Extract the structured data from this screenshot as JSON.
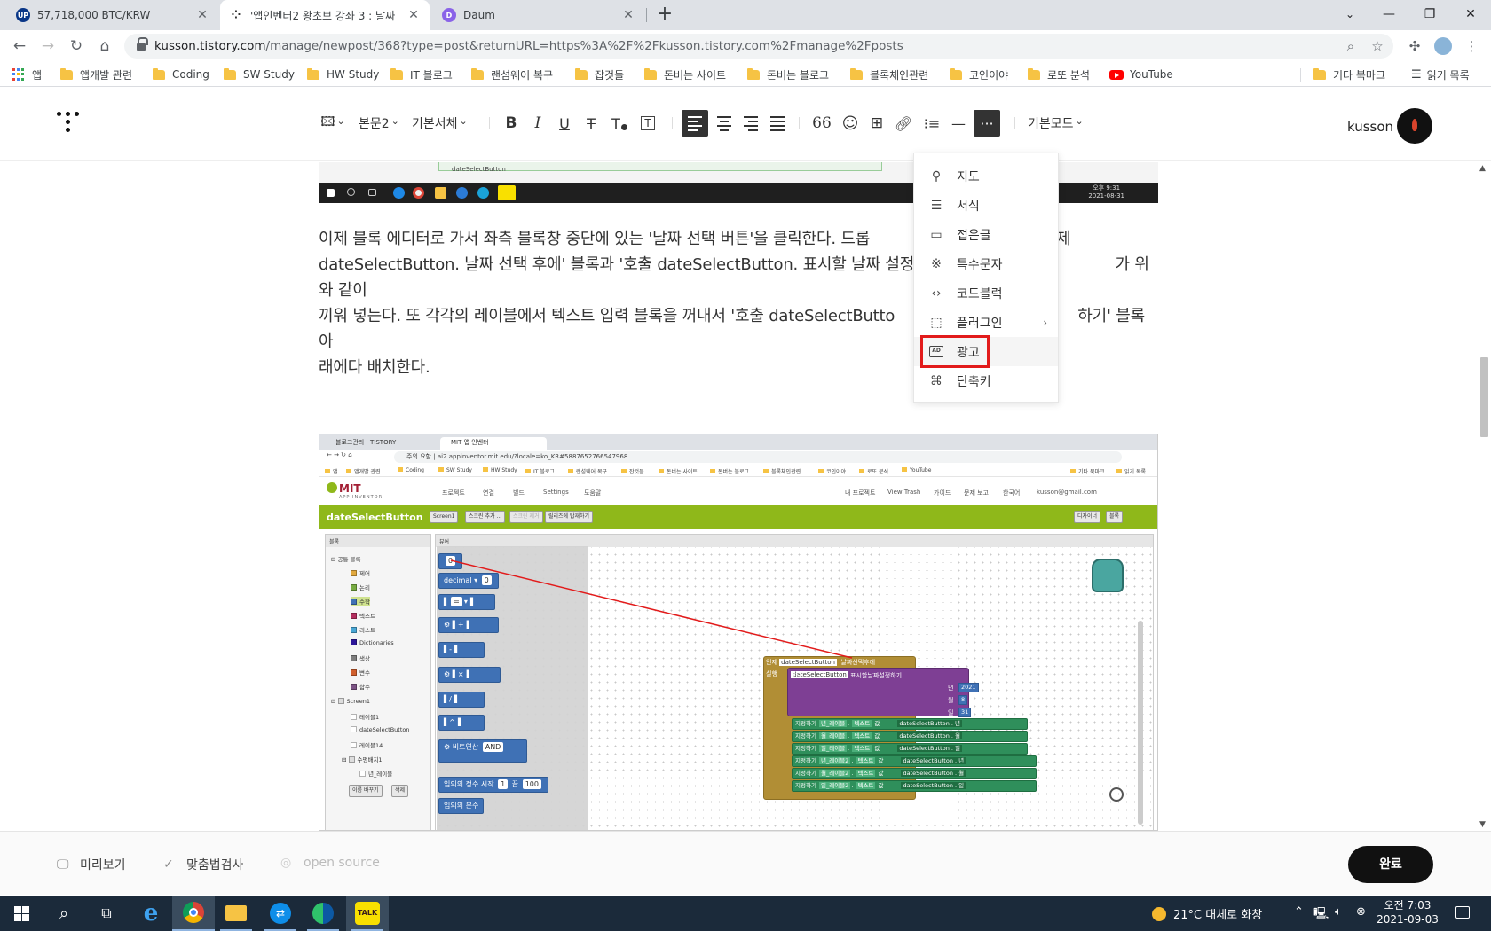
{
  "browser": {
    "tabs": [
      {
        "title": "57,718,000 BTC/KRW",
        "favicon_text": "UP",
        "favicon_color": "#093687",
        "active": false
      },
      {
        "title": "'앱인벤터2 왕초보 강좌 3 : 날짜",
        "favicon_text": "t",
        "favicon_color": "#333333",
        "active": true
      },
      {
        "title": "Daum",
        "favicon_text": "D",
        "favicon_color": "#8a63e8",
        "active": false
      }
    ],
    "new_tab_label": "+",
    "url_host": "kusson.tistory.com",
    "url_path": "/manage/newpost/368?type=post&returnURL=https%3A%2F%2Fkusson.tistory.com%2Fmanage%2Fposts",
    "bookmarks": [
      {
        "label": "앱",
        "type": "apps"
      },
      {
        "label": "앱개발 관련",
        "type": "folder"
      },
      {
        "label": "Coding",
        "type": "folder"
      },
      {
        "label": "SW Study",
        "type": "folder"
      },
      {
        "label": "HW Study",
        "type": "folder"
      },
      {
        "label": "IT 블로그",
        "type": "folder"
      },
      {
        "label": "랜섬웨어 복구",
        "type": "folder"
      },
      {
        "label": "잡것들",
        "type": "folder"
      },
      {
        "label": "돈버는 사이트",
        "type": "folder"
      },
      {
        "label": "돈버는 블로그",
        "type": "folder"
      },
      {
        "label": "블록체인관련",
        "type": "folder"
      },
      {
        "label": "코인이야",
        "type": "folder"
      },
      {
        "label": "로또 분석",
        "type": "folder"
      },
      {
        "label": "YouTube",
        "type": "youtube"
      }
    ],
    "bookmarks_right": [
      {
        "label": "기타 북마크",
        "type": "folder"
      },
      {
        "label": "읽기 목록",
        "type": "reading-list"
      }
    ]
  },
  "editor": {
    "toolbar": {
      "paragraph_style": "본문2",
      "font": "기본서체",
      "mode": "기본모드",
      "quote_glyph": "66"
    },
    "username": "kusson",
    "paragraph": "이제 블록 에디터로 가서 좌측 블록창 중단에 있는 '날짜 선택 버튼'을 클릭한다. 드롭 메뉴에서 '언제 dateSelectButton. 날짜 선택 후에' 블록과 '호출 dateSelectButton. 표시할 날짜 설정하기' 블록을 찾아서 블록 조각 퍼즐 형태가 위와 같이 끼워 넣는다. 또 각각의 레이블에서 텍스트 입력 블록을 꺼내서 '호출 dateSelectButton. 표시할 날짜 설정하기' 블록 아래에다 배치한다.",
    "paragraph_line1_visible": "이제 블록 에디터로 가서 좌측 블록창 중단에 있는 '날짜 선택 버튼'을 클릭한다. 드롭",
    "paragraph_line1_tail": "제",
    "paragraph_line2_visible": "dateSelectButton. 날짜 선택 후에' 블록과 '호출 dateSelectButton. 표시할 날짜 설정하",
    "paragraph_line2_tail": "가 위와 같이",
    "paragraph_line3_visible": "끼워 넣는다. 또 각각의 레이블에서 텍스트 입력 블록을 꺼내서 '호출 dateSelectButto",
    "paragraph_line3_tail": "하기' 블록 아",
    "paragraph_line4_visible": "래에다 배치한다.",
    "more_menu": [
      {
        "label": "지도",
        "icon": "map-pin-icon"
      },
      {
        "label": "서식",
        "icon": "template-icon"
      },
      {
        "label": "접은글",
        "icon": "fold-icon"
      },
      {
        "label": "특수문자",
        "icon": "special-char-icon"
      },
      {
        "label": "코드블럭",
        "icon": "code-icon"
      },
      {
        "label": "플러그인",
        "icon": "plugin-icon",
        "submenu": true
      },
      {
        "label": "광고",
        "icon": "ad-icon",
        "highlighted": true
      },
      {
        "label": "단축키",
        "icon": "command-icon"
      }
    ],
    "footer": {
      "preview": "미리보기",
      "spellcheck": "맞춤법검사",
      "open_source": "open source",
      "done": "완료"
    }
  },
  "embedded_screenshot_1": {
    "clock_time": "오후 9:31",
    "clock_date": "2021-08-31",
    "status_text": "dateSelectButton"
  },
  "embedded_screenshot_2": {
    "tabs": [
      "블로그관리 | TISTORY",
      "MIT 앱 인벤터"
    ],
    "url": "ai2.appinventor.mit.edu/?locale=ko_KR#5887652766547968",
    "url_warning": "주의 요함",
    "bookmarks": [
      "앱",
      "앱개발 관련",
      "Coding",
      "SW Study",
      "HW Study",
      "IT 블로그",
      "랜섬웨어 복구",
      "잡것들",
      "돈버는 사이트",
      "돈버는 블로그",
      "블록체인관련",
      "코인이야",
      "로또 분석",
      "YouTube",
      "기타 북마크",
      "읽기 목록"
    ],
    "logo": "MIT",
    "logo_sub": "APP INVENTOR",
    "menus": [
      "프로젝트",
      "연결",
      "빌드",
      "Settings",
      "도움말"
    ],
    "right_menus": [
      "내 프로젝트",
      "View Trash",
      "가이드",
      "문제 보고",
      "한국어",
      "kusson@gmail.com"
    ],
    "project_title": "dateSelectButton",
    "screen_buttons": [
      "Screen1",
      "스크린 추가 ...",
      "스크린 제거",
      "릴리즈에 탑재하기"
    ],
    "right_buttons": [
      "디자이너",
      "블록"
    ],
    "palette_header": "블록",
    "palette_items": [
      {
        "label": "공통 블록",
        "color": "#ffffff"
      },
      {
        "label": "제어",
        "color": "#e1a83d"
      },
      {
        "label": "논리",
        "color": "#77ab41"
      },
      {
        "label": "수학",
        "color": "#3f71b5"
      },
      {
        "label": "텍스트",
        "color": "#b32d5e"
      },
      {
        "label": "리스트",
        "color": "#49a6d4"
      },
      {
        "label": "Dictionaries",
        "color": "#2d1799"
      },
      {
        "label": "색상",
        "color": "#7d7d7d"
      },
      {
        "label": "변수",
        "color": "#d05f2d"
      },
      {
        "label": "함수",
        "color": "#7c5385"
      },
      {
        "label": "Screen1",
        "color": "#dddddd"
      },
      {
        "label": "레이블1",
        "color": "#ffffff"
      },
      {
        "label": "dateSelectButton",
        "color": "#ffffff"
      },
      {
        "label": "레이블14",
        "color": "#ffffff"
      },
      {
        "label": "수평배치1",
        "color": "#ffffff"
      },
      {
        "label": "년_레이블",
        "color": "#ffffff"
      }
    ],
    "palette_buttons": [
      "이름 바꾸기",
      "삭제"
    ],
    "workspace_header": "뷰어",
    "math_blocks": [
      "0",
      "decimal",
      "=",
      "+",
      "-",
      "×",
      "/",
      "^",
      "비트연산 AND",
      "임의의 정수 시작 1 끝 100",
      "임의의 분수"
    ],
    "decimal_value": "0",
    "and_label": "비트연산",
    "and_op": "AND",
    "random_label": "임의의 정수 시작",
    "random_from": "1",
    "random_to_label": "끝",
    "random_to": "100",
    "random_fraction": "임의의 분수",
    "event_block": {
      "when": "언제",
      "component": "dateSelectButton",
      "event": ".날짜선택후에",
      "do": "실행"
    },
    "call_block": {
      "call": "호출",
      "component": "dateSelectButton",
      "method": ".표시할날짜설정하기",
      "year_label": "년",
      "year": "2021",
      "month_label": "월",
      "month": "8",
      "day_label": "일",
      "day": "31"
    },
    "set_rows": [
      {
        "set": "지정하기",
        "component": "년_레이블",
        "prop": "텍스트",
        "to": "값",
        "src": "dateSelectButton",
        "src_prop": "년"
      },
      {
        "set": "지정하기",
        "component": "월_레이블",
        "prop": "텍스트",
        "to": "값",
        "src": "dateSelectButton",
        "src_prop": "월"
      },
      {
        "set": "지정하기",
        "component": "일_레이블",
        "prop": "텍스트",
        "to": "값",
        "src": "dateSelectButton",
        "src_prop": "일"
      },
      {
        "set": "지정하기",
        "component": "년_레이블2",
        "prop": "텍스트",
        "to": "값",
        "src": "dateSelectButton",
        "src_prop": "년"
      },
      {
        "set": "지정하기",
        "component": "월_레이블2",
        "prop": "텍스트",
        "to": "값",
        "src": "dateSelectButton",
        "src_prop": "월"
      },
      {
        "set": "지정하기",
        "component": "일_레이블2",
        "prop": "텍스트",
        "to": "값",
        "src": "dateSelectButton",
        "src_prop": "일"
      }
    ]
  },
  "taskbar": {
    "weather": "21°C 대체로 화창",
    "time": "오전 7:03",
    "date": "2021-09-03",
    "talk_label": "TALK"
  },
  "colors": {
    "highlight_red": "#e21b1b",
    "tistory_dark": "#333333",
    "appinventor_green": "#8fb81a",
    "math_block": "#3f71b5",
    "event_block": "#b18e35",
    "method_block": "#7e3f94",
    "setter_block": "#2f8f5b"
  }
}
